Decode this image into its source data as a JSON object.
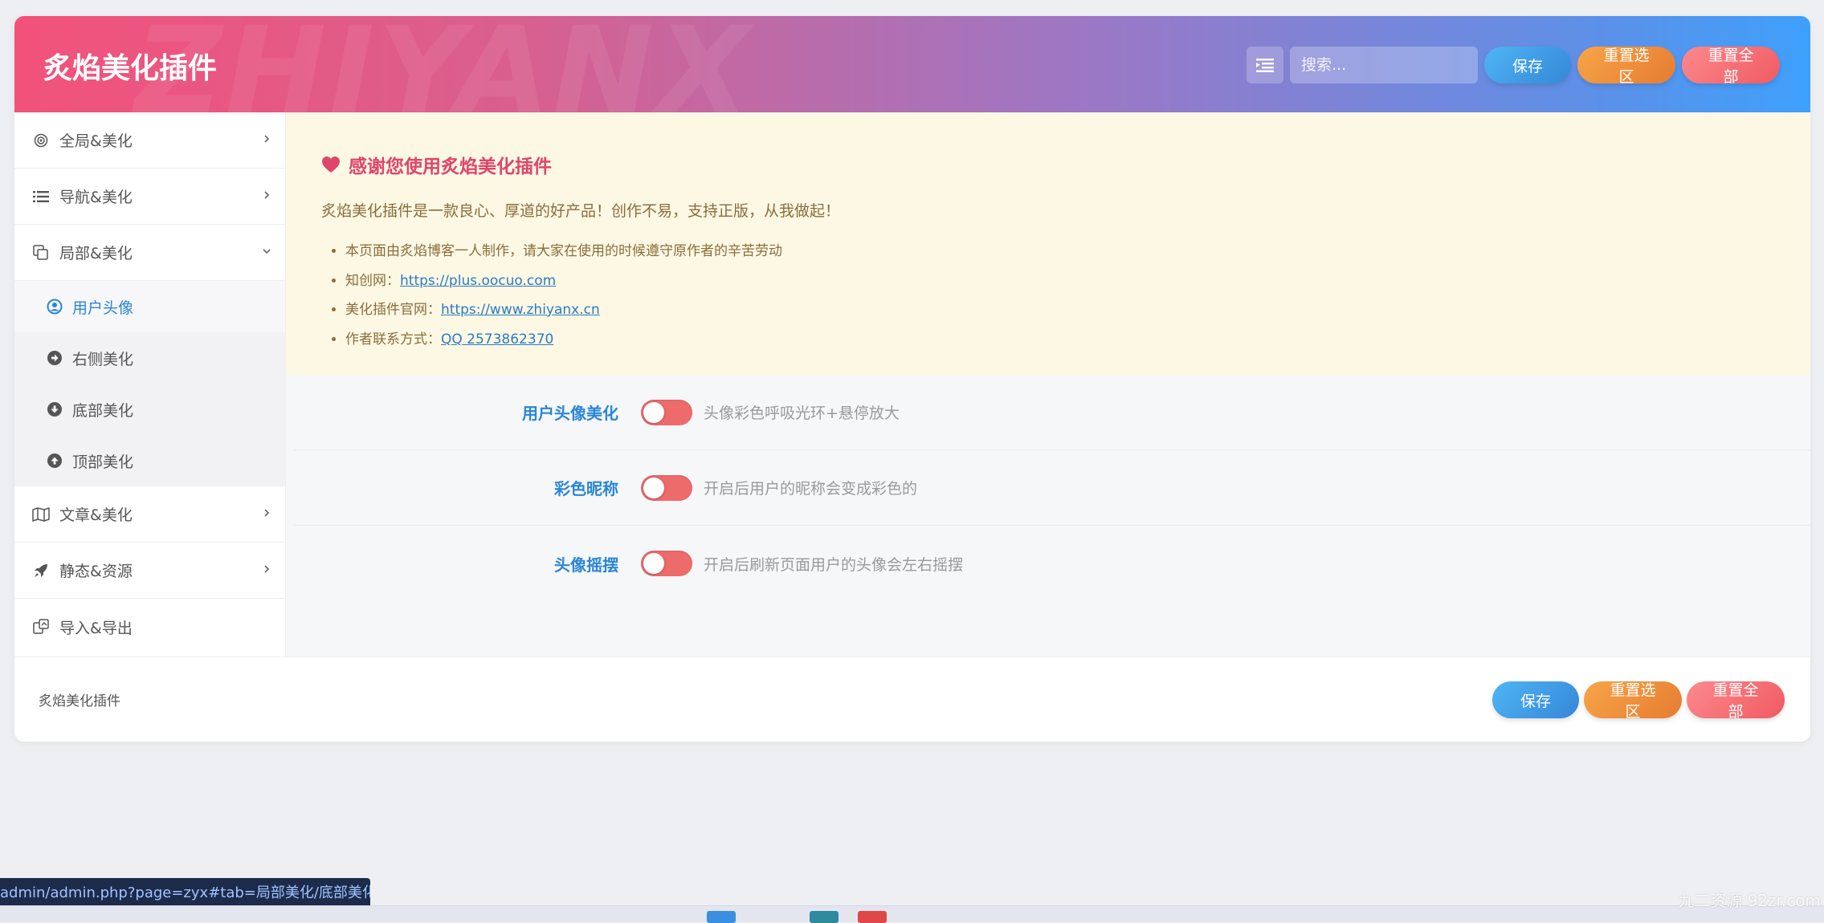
{
  "header": {
    "brand": "炙焰美化插件",
    "watermark": "ZHIYANX",
    "search_placeholder": "搜索...",
    "save_label": "保存",
    "reset_section_label": "重置选区",
    "reset_all_label": "重置全部"
  },
  "sidebar": {
    "items": [
      {
        "label": "全局&美化",
        "icon": "target-icon"
      },
      {
        "label": "导航&美化",
        "icon": "list-icon"
      },
      {
        "label": "局部&美化",
        "icon": "copy-icon"
      },
      {
        "label": "文章&美化",
        "icon": "map-icon"
      },
      {
        "label": "静态&资源",
        "icon": "rocket-icon"
      },
      {
        "label": "导入&导出",
        "icon": "transfer-icon"
      }
    ],
    "subitems": [
      {
        "label": "用户头像",
        "icon": "user-circle-icon",
        "active": true
      },
      {
        "label": "右侧美化",
        "icon": "arrow-right-circle-icon"
      },
      {
        "label": "底部美化",
        "icon": "arrow-down-circle-icon"
      },
      {
        "label": "顶部美化",
        "icon": "arrow-up-circle-icon"
      }
    ]
  },
  "notice": {
    "title": "感谢您使用炙焰美化插件",
    "desc": "炙焰美化插件是一款良心、厚道的好产品！创作不易，支持正版，从我做起！",
    "items": [
      {
        "text": "本页面由炙焰博客一人制作，请大家在使用的时候遵守原作者的辛苦劳动",
        "link": ""
      },
      {
        "text": "知创网：",
        "link": "https://plus.oocuo.com"
      },
      {
        "text": "美化插件官网：",
        "link": "https://www.zhiyanx.cn"
      },
      {
        "text": "作者联系方式：",
        "link": "QQ 2573862370"
      }
    ]
  },
  "fields": [
    {
      "label": "用户头像美化",
      "desc": "头像彩色呼吸光环+悬停放大",
      "enabled": false
    },
    {
      "label": "彩色昵称",
      "desc": "开启后用户的昵称会变成彩色的",
      "enabled": false
    },
    {
      "label": "头像摇摆",
      "desc": "开启后刷新页面用户的头像会左右摇摆",
      "enabled": false
    }
  ],
  "footer": {
    "brand": "炙焰美化插件",
    "save_label": "保存",
    "reset_section_label": "重置选区",
    "reset_all_label": "重置全部"
  },
  "status_url": "admin/admin.php?page=zyx#tab=局部美化/底部美化",
  "corner_watermark": "九二资源 92zr.com",
  "colors": {
    "accent_blue": "#2a86d5",
    "notice_title": "#e0456a",
    "toggle_off": "#ee6b6b"
  }
}
